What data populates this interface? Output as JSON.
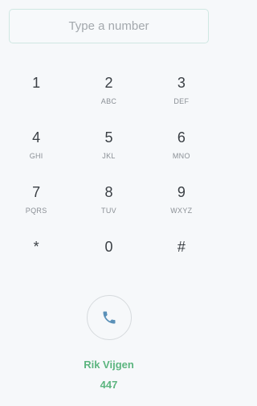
{
  "input": {
    "placeholder": "Type a number",
    "value": ""
  },
  "keypad": {
    "rows": [
      [
        {
          "digit": "1",
          "letters": ""
        },
        {
          "digit": "2",
          "letters": "ABC"
        },
        {
          "digit": "3",
          "letters": "DEF"
        }
      ],
      [
        {
          "digit": "4",
          "letters": "GHI"
        },
        {
          "digit": "5",
          "letters": "JKL"
        },
        {
          "digit": "6",
          "letters": "MNO"
        }
      ],
      [
        {
          "digit": "7",
          "letters": "PQRS"
        },
        {
          "digit": "8",
          "letters": "TUV"
        },
        {
          "digit": "9",
          "letters": "WXYZ"
        }
      ],
      [
        {
          "digit": "*",
          "letters": ""
        },
        {
          "digit": "0",
          "letters": ""
        },
        {
          "digit": "#",
          "letters": ""
        }
      ]
    ]
  },
  "call_button": {
    "icon": "phone-icon",
    "icon_color": "#5a90b8"
  },
  "contact": {
    "name": "Rik Vijgen",
    "number": "447"
  },
  "colors": {
    "accent": "#5cb57f",
    "input_border": "#cfe7e2",
    "background": "#f6f8fa"
  }
}
